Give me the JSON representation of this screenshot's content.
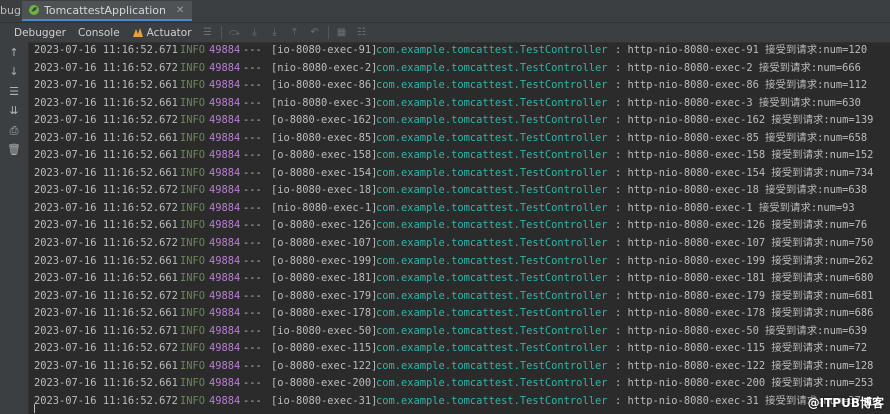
{
  "panel": {
    "label": "bug:",
    "run_tab": "TomcattestApplication",
    "tabs": [
      "Debugger",
      "Console",
      "Actuator"
    ]
  },
  "log": {
    "level": "INFO",
    "pid": "49884",
    "separator": "---",
    "logger": "com.example.tomcattest.TestController",
    "lines": [
      {
        "ts": "2023-07-16 11:16:52.671",
        "thread": "[io-8080-exec-91]",
        "msg": ": http-nio-8080-exec-91 接受到请求:num=120"
      },
      {
        "ts": "2023-07-16 11:16:52.672",
        "thread": "[nio-8080-exec-2]",
        "msg": ": http-nio-8080-exec-2 接受到请求:num=666"
      },
      {
        "ts": "2023-07-16 11:16:52.661",
        "thread": "[io-8080-exec-86]",
        "msg": ": http-nio-8080-exec-86 接受到请求:num=112"
      },
      {
        "ts": "2023-07-16 11:16:52.661",
        "thread": "[nio-8080-exec-3]",
        "msg": ": http-nio-8080-exec-3 接受到请求:num=630"
      },
      {
        "ts": "2023-07-16 11:16:52.672",
        "thread": "[o-8080-exec-162]",
        "msg": ": http-nio-8080-exec-162 接受到请求:num=139"
      },
      {
        "ts": "2023-07-16 11:16:52.661",
        "thread": "[io-8080-exec-85]",
        "msg": ": http-nio-8080-exec-85 接受到请求:num=658"
      },
      {
        "ts": "2023-07-16 11:16:52.661",
        "thread": "[o-8080-exec-158]",
        "msg": ": http-nio-8080-exec-158 接受到请求:num=152"
      },
      {
        "ts": "2023-07-16 11:16:52.661",
        "thread": "[o-8080-exec-154]",
        "msg": ": http-nio-8080-exec-154 接受到请求:num=734"
      },
      {
        "ts": "2023-07-16 11:16:52.672",
        "thread": "[io-8080-exec-18]",
        "msg": ": http-nio-8080-exec-18 接受到请求:num=638"
      },
      {
        "ts": "2023-07-16 11:16:52.672",
        "thread": "[nio-8080-exec-1]",
        "msg": ": http-nio-8080-exec-1 接受到请求:num=93"
      },
      {
        "ts": "2023-07-16 11:16:52.661",
        "thread": "[o-8080-exec-126]",
        "msg": ": http-nio-8080-exec-126 接受到请求:num=76"
      },
      {
        "ts": "2023-07-16 11:16:52.672",
        "thread": "[o-8080-exec-107]",
        "msg": ": http-nio-8080-exec-107 接受到请求:num=750"
      },
      {
        "ts": "2023-07-16 11:16:52.661",
        "thread": "[o-8080-exec-199]",
        "msg": ": http-nio-8080-exec-199 接受到请求:num=262"
      },
      {
        "ts": "2023-07-16 11:16:52.661",
        "thread": "[o-8080-exec-181]",
        "msg": ": http-nio-8080-exec-181 接受到请求:num=680"
      },
      {
        "ts": "2023-07-16 11:16:52.672",
        "thread": "[o-8080-exec-179]",
        "msg": ": http-nio-8080-exec-179 接受到请求:num=681"
      },
      {
        "ts": "2023-07-16 11:16:52.661",
        "thread": "[o-8080-exec-178]",
        "msg": ": http-nio-8080-exec-178 接受到请求:num=686"
      },
      {
        "ts": "2023-07-16 11:16:52.671",
        "thread": "[io-8080-exec-50]",
        "msg": ": http-nio-8080-exec-50 接受到请求:num=639"
      },
      {
        "ts": "2023-07-16 11:16:52.672",
        "thread": "[o-8080-exec-115]",
        "msg": ": http-nio-8080-exec-115 接受到请求:num=72"
      },
      {
        "ts": "2023-07-16 11:16:52.661",
        "thread": "[o-8080-exec-122]",
        "msg": ": http-nio-8080-exec-122 接受到请求:num=128"
      },
      {
        "ts": "2023-07-16 11:16:52.661",
        "thread": "[o-8080-exec-200]",
        "msg": ": http-nio-8080-exec-200 接受到请求:num=253"
      },
      {
        "ts": "2023-07-16 11:16:52.672",
        "thread": "[io-8080-exec-31]",
        "msg": ": http-nio-8080-exec-31 接受到请求:num=37"
      }
    ]
  },
  "watermark": "@ITPUB博客",
  "colors": {
    "background": "#2b2b2b",
    "info_level": "#6a8759",
    "pid": "#b77fcf",
    "logger": "#2fb5a8",
    "text": "#bbbbbb"
  },
  "icons": [
    "up-arrow-icon",
    "down-arrow-icon",
    "soft-wrap-icon",
    "scroll-to-end-icon",
    "print-icon",
    "trash-icon"
  ]
}
